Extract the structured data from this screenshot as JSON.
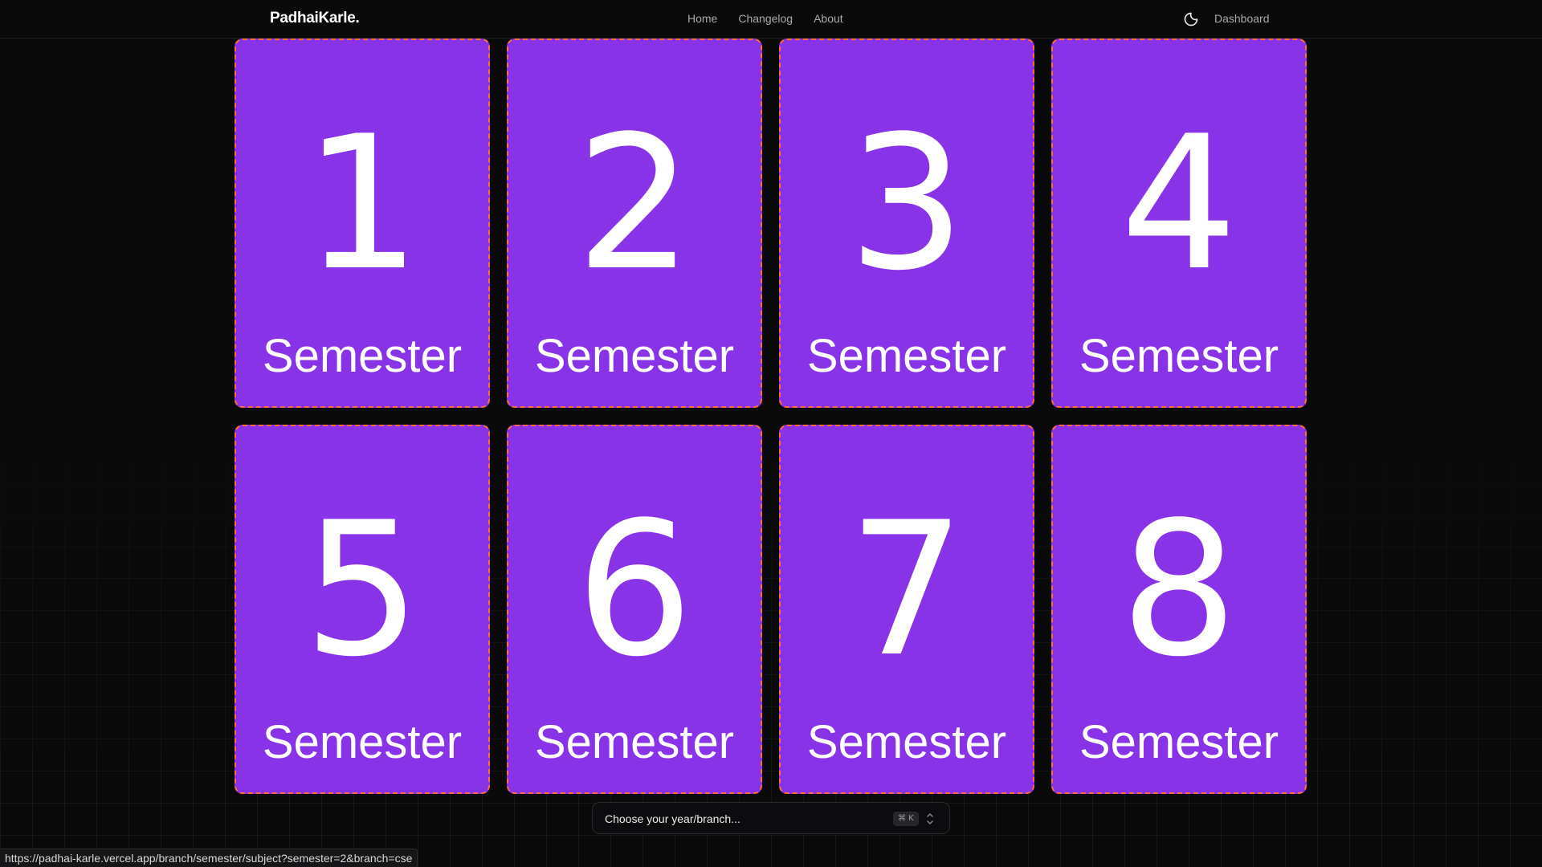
{
  "header": {
    "brand": "PadhaiKarle.",
    "nav": [
      "Home",
      "Changelog",
      "About"
    ],
    "dashboard_label": "Dashboard",
    "theme_icon": "moon-icon"
  },
  "semesters": [
    {
      "number": "1",
      "label": "Semester"
    },
    {
      "number": "2",
      "label": "Semester"
    },
    {
      "number": "3",
      "label": "Semester"
    },
    {
      "number": "4",
      "label": "Semester"
    },
    {
      "number": "5",
      "label": "Semester"
    },
    {
      "number": "6",
      "label": "Semester"
    },
    {
      "number": "7",
      "label": "Semester"
    },
    {
      "number": "8",
      "label": "Semester"
    }
  ],
  "combobox": {
    "placeholder": "Choose your year/branch...",
    "shortcut": "⌘ K"
  },
  "status_url": "https://padhai-karle.vercel.app/branch/semester/subject?semester=2&branch=cse",
  "colors": {
    "card_bg": "#8833e8",
    "card_border": "#ff6b3a",
    "page_bg": "#0a0a0b"
  }
}
